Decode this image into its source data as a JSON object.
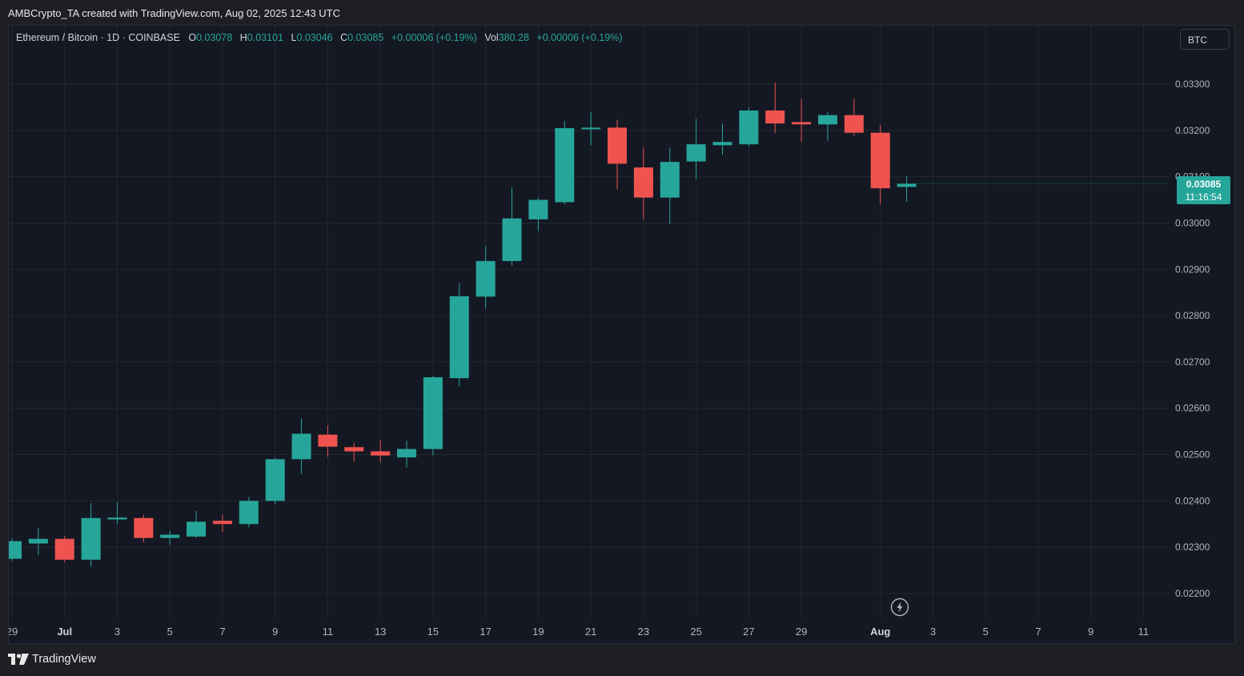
{
  "caption": "AMBCrypto_TA created with TradingView.com, Aug 02, 2025 12:43 UTC",
  "legend": {
    "symbol": "Ethereum / Bitcoin · 1D · COINBASE",
    "o_label": "O",
    "o_value": "0.03078",
    "h_label": "H",
    "h_value": "0.03101",
    "l_label": "L",
    "l_value": "0.03046",
    "c_label": "C",
    "c_value": "0.03085",
    "change": "+0.00006 (+0.19%)",
    "vol_label": "Vol",
    "vol_value": "380.28",
    "vol_change": "+0.00006 (+0.19%)"
  },
  "currency_button": "BTC",
  "price_badge": {
    "price": "0.03085",
    "countdown": "11:16:54"
  },
  "brand": "TradingView",
  "colors": {
    "up": "#26a69a",
    "down": "#ef5350",
    "background": "#141823",
    "grid": "#232733",
    "text": "#b2b5be"
  },
  "chart_data": {
    "type": "candlestick",
    "interval": "1D",
    "ylim": [
      0.0215,
      0.0331
    ],
    "y_ticks": [
      "0.02200",
      "0.02300",
      "0.02400",
      "0.02500",
      "0.02600",
      "0.02700",
      "0.02800",
      "0.02900",
      "0.03000",
      "0.03100",
      "0.03200",
      "0.03300"
    ],
    "x_ticks": [
      {
        "label": "29",
        "day": 0
      },
      {
        "label": "Jul",
        "day": 2
      },
      {
        "label": "3",
        "day": 4
      },
      {
        "label": "5",
        "day": 6
      },
      {
        "label": "7",
        "day": 8
      },
      {
        "label": "9",
        "day": 10
      },
      {
        "label": "11",
        "day": 12
      },
      {
        "label": "13",
        "day": 14
      },
      {
        "label": "15",
        "day": 16
      },
      {
        "label": "17",
        "day": 18
      },
      {
        "label": "19",
        "day": 20
      },
      {
        "label": "21",
        "day": 22
      },
      {
        "label": "23",
        "day": 24
      },
      {
        "label": "25",
        "day": 26
      },
      {
        "label": "27",
        "day": 28
      },
      {
        "label": "29",
        "day": 30
      },
      {
        "label": "Aug",
        "day": 33
      },
      {
        "label": "3",
        "day": 35
      },
      {
        "label": "5",
        "day": 37
      },
      {
        "label": "7",
        "day": 39
      },
      {
        "label": "9",
        "day": 41
      },
      {
        "label": "11",
        "day": 43
      }
    ],
    "candles": [
      {
        "date": "2025-06-29",
        "o": 0.02275,
        "h": 0.0232,
        "l": 0.0227,
        "c": 0.02313
      },
      {
        "date": "2025-06-30",
        "o": 0.02308,
        "h": 0.02342,
        "l": 0.02283,
        "c": 0.02318
      },
      {
        "date": "2025-07-01",
        "o": 0.02318,
        "h": 0.02325,
        "l": 0.02268,
        "c": 0.02273
      },
      {
        "date": "2025-07-02",
        "o": 0.02273,
        "h": 0.02395,
        "l": 0.02258,
        "c": 0.02363
      },
      {
        "date": "2025-07-03",
        "o": 0.0236,
        "h": 0.02397,
        "l": 0.0235,
        "c": 0.02364
      },
      {
        "date": "2025-07-04",
        "o": 0.02363,
        "h": 0.0237,
        "l": 0.0231,
        "c": 0.0232
      },
      {
        "date": "2025-07-05",
        "o": 0.0232,
        "h": 0.02335,
        "l": 0.02305,
        "c": 0.02327
      },
      {
        "date": "2025-07-06",
        "o": 0.02323,
        "h": 0.02378,
        "l": 0.0232,
        "c": 0.02355
      },
      {
        "date": "2025-07-07",
        "o": 0.02357,
        "h": 0.0237,
        "l": 0.02332,
        "c": 0.0235
      },
      {
        "date": "2025-07-08",
        "o": 0.0235,
        "h": 0.02408,
        "l": 0.02343,
        "c": 0.024
      },
      {
        "date": "2025-07-09",
        "o": 0.024,
        "h": 0.02493,
        "l": 0.02393,
        "c": 0.0249
      },
      {
        "date": "2025-07-10",
        "o": 0.0249,
        "h": 0.02578,
        "l": 0.02458,
        "c": 0.02545
      },
      {
        "date": "2025-07-11",
        "o": 0.02543,
        "h": 0.02563,
        "l": 0.02495,
        "c": 0.02517
      },
      {
        "date": "2025-07-12",
        "o": 0.02516,
        "h": 0.02525,
        "l": 0.02485,
        "c": 0.02507
      },
      {
        "date": "2025-07-13",
        "o": 0.02507,
        "h": 0.02532,
        "l": 0.02483,
        "c": 0.02498
      },
      {
        "date": "2025-07-14",
        "o": 0.02494,
        "h": 0.0253,
        "l": 0.02472,
        "c": 0.02512
      },
      {
        "date": "2025-07-15",
        "o": 0.02512,
        "h": 0.0267,
        "l": 0.02498,
        "c": 0.02667
      },
      {
        "date": "2025-07-16",
        "o": 0.02665,
        "h": 0.0287,
        "l": 0.02648,
        "c": 0.02842
      },
      {
        "date": "2025-07-17",
        "o": 0.02841,
        "h": 0.0295,
        "l": 0.02815,
        "c": 0.02918
      },
      {
        "date": "2025-07-18",
        "o": 0.02918,
        "h": 0.03077,
        "l": 0.02908,
        "c": 0.0301
      },
      {
        "date": "2025-07-19",
        "o": 0.03008,
        "h": 0.03055,
        "l": 0.02983,
        "c": 0.0305
      },
      {
        "date": "2025-07-20",
        "o": 0.03045,
        "h": 0.0322,
        "l": 0.0304,
        "c": 0.03205
      },
      {
        "date": "2025-07-21",
        "o": 0.03205,
        "h": 0.0324,
        "l": 0.03168,
        "c": 0.03206
      },
      {
        "date": "2025-07-22",
        "o": 0.03206,
        "h": 0.03223,
        "l": 0.03073,
        "c": 0.03128
      },
      {
        "date": "2025-07-23",
        "o": 0.0312,
        "h": 0.03163,
        "l": 0.03007,
        "c": 0.03055
      },
      {
        "date": "2025-07-24",
        "o": 0.03055,
        "h": 0.03163,
        "l": 0.02998,
        "c": 0.03132
      },
      {
        "date": "2025-07-25",
        "o": 0.03133,
        "h": 0.03225,
        "l": 0.03095,
        "c": 0.0317
      },
      {
        "date": "2025-07-26",
        "o": 0.03168,
        "h": 0.03215,
        "l": 0.03148,
        "c": 0.03175
      },
      {
        "date": "2025-07-27",
        "o": 0.0317,
        "h": 0.0325,
        "l": 0.03165,
        "c": 0.03243
      },
      {
        "date": "2025-07-28",
        "o": 0.03243,
        "h": 0.03303,
        "l": 0.03195,
        "c": 0.03215
      },
      {
        "date": "2025-07-29",
        "o": 0.03218,
        "h": 0.03268,
        "l": 0.03175,
        "c": 0.03213
      },
      {
        "date": "2025-07-30",
        "o": 0.03213,
        "h": 0.0324,
        "l": 0.03178,
        "c": 0.03233
      },
      {
        "date": "2025-07-31",
        "o": 0.03233,
        "h": 0.03268,
        "l": 0.03188,
        "c": 0.03195
      },
      {
        "date": "2025-08-01",
        "o": 0.03195,
        "h": 0.03212,
        "l": 0.0304,
        "c": 0.03075
      },
      {
        "date": "2025-08-02",
        "o": 0.03078,
        "h": 0.03101,
        "l": 0.03046,
        "c": 0.03085
      }
    ]
  }
}
